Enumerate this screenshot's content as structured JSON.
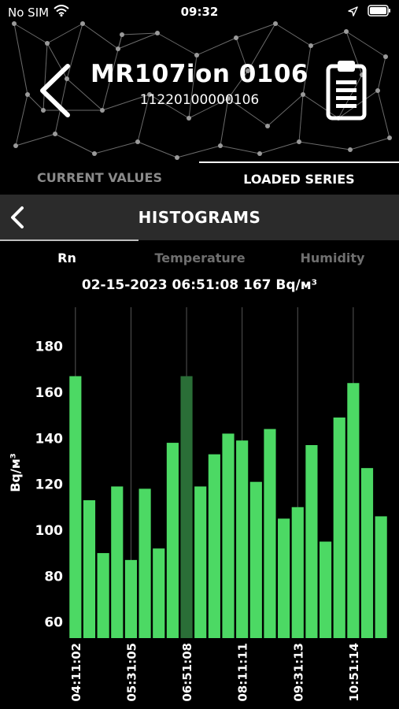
{
  "status_bar": {
    "carrier": "No SIM",
    "time": "09:32",
    "icons": [
      "wifi-icon",
      "location-arrow-icon",
      "battery-icon"
    ]
  },
  "header": {
    "device_name": "MR107ion 0106",
    "serial": "11220100000106",
    "icons": [
      "back-chevron-icon",
      "clipboard-icon"
    ]
  },
  "main_tabs": [
    {
      "label": "CURRENT VALUES",
      "active": false
    },
    {
      "label": "LOADED SERIES",
      "active": true
    }
  ],
  "subheader": {
    "title": "HISTOGRAMS"
  },
  "param_tabs": [
    {
      "label": "Rn",
      "active": true
    },
    {
      "label": "Temperature",
      "active": false
    },
    {
      "label": "Humidity",
      "active": false
    }
  ],
  "reading": "02-15-2023 06:51:08 167 Bq/м³",
  "colors": {
    "bar": "#4cd964",
    "bar_selected": "#2a6e37",
    "grid": "#555555",
    "subheader_bg": "#2b2b2b"
  },
  "chart_data": {
    "type": "bar",
    "ylabel": "Bq/м³",
    "ylim": [
      53,
      197
    ],
    "yticks": [
      60,
      80,
      100,
      120,
      140,
      160,
      180
    ],
    "xtick_labels": [
      "04:11:02",
      "05:31:05",
      "06:51:08",
      "08:11:11",
      "09:31:13",
      "10:51:14"
    ],
    "xtick_bar_index": [
      0,
      4,
      8,
      12,
      16,
      20
    ],
    "selected_index": 8,
    "values": [
      167,
      113,
      90,
      119,
      87,
      118,
      92,
      138,
      167,
      119,
      133,
      142,
      139,
      121,
      144,
      105,
      110,
      137,
      95,
      149,
      164,
      127,
      106
    ],
    "grid": true
  }
}
